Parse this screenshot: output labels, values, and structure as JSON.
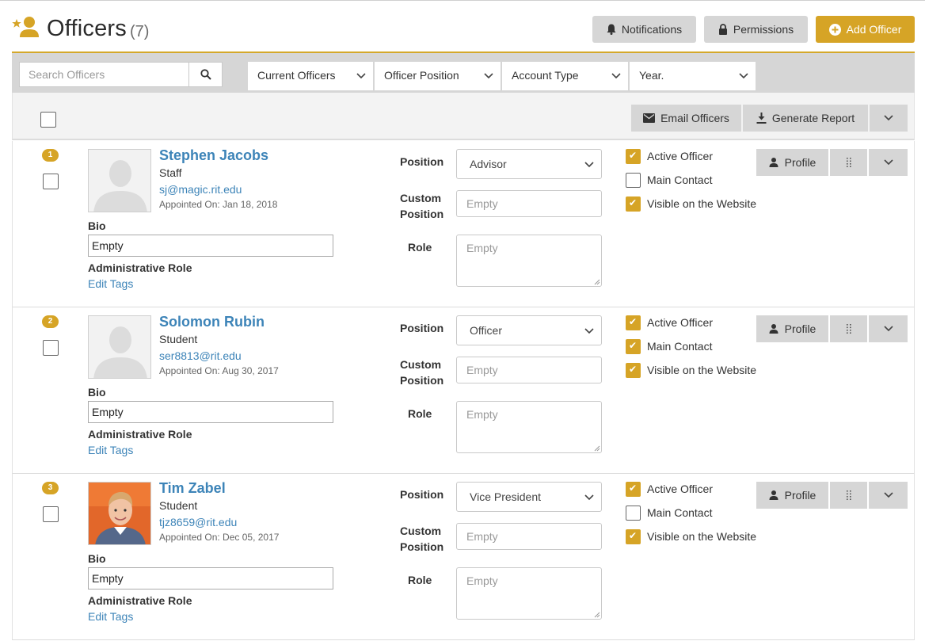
{
  "header": {
    "title": "Officers",
    "count": "(7)",
    "notifications_label": "Notifications",
    "permissions_label": "Permissions",
    "add_officer_label": "Add Officer"
  },
  "filters": {
    "search_placeholder": "Search Officers",
    "current_officers": "Current Officers",
    "officer_position": "Officer Position",
    "account_type": "Account Type",
    "year": "Year."
  },
  "toolbar": {
    "email_label": "Email Officers",
    "report_label": "Generate Report"
  },
  "labels": {
    "position": "Position",
    "custom": "Custom",
    "position2": "Position",
    "role": "Role",
    "bio": "Bio",
    "admin_role": "Administrative Role",
    "edit_tags": "Edit Tags",
    "active": "Active Officer",
    "main": "Main Contact",
    "visible": "Visible on the Website",
    "profile": "Profile",
    "empty": "Empty"
  },
  "colors": {
    "accent": "#d6a426",
    "link": "#3d84b8",
    "button_grey": "#d6d6d6"
  },
  "officers": [
    {
      "index": "1",
      "name": "Stephen Jacobs",
      "type": "Staff",
      "email": "sj@magic.rit.edu",
      "appointed": "Appointed On: Jan 18, 2018",
      "bio": "Empty",
      "position": "Advisor",
      "custom_position": "Empty",
      "role": "Empty",
      "active": true,
      "main_contact": false,
      "visible": true,
      "photo": "placeholder-avatar"
    },
    {
      "index": "2",
      "name": "Solomon Rubin",
      "type": "Student",
      "email": "ser8813@rit.edu",
      "appointed": "Appointed On: Aug 30, 2017",
      "bio": "Empty",
      "position": "Officer",
      "custom_position": "Empty",
      "role": "Empty",
      "active": true,
      "main_contact": true,
      "visible": true,
      "photo": "placeholder-avatar"
    },
    {
      "index": "3",
      "name": "Tim Zabel",
      "type": "Student",
      "email": "tjz8659@rit.edu",
      "appointed": "Appointed On: Dec 05, 2017",
      "bio": "Empty",
      "position": "Vice President",
      "custom_position": "Empty",
      "role": "Empty",
      "active": true,
      "main_contact": false,
      "visible": true,
      "photo": "profile-photo"
    }
  ]
}
